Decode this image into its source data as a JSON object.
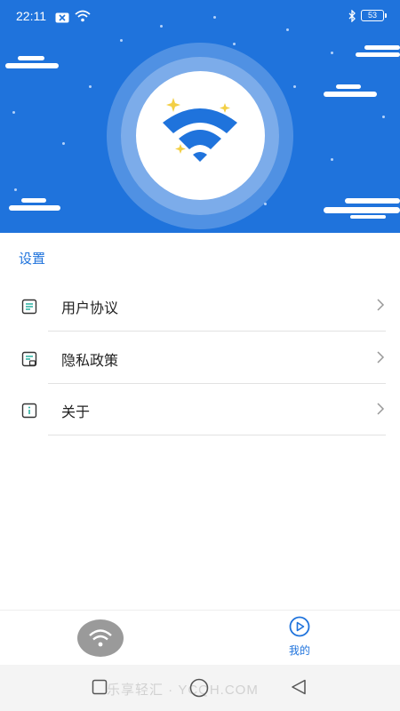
{
  "status_bar": {
    "time": "22:11",
    "battery": "53",
    "icons": [
      "notification-close-icon",
      "wifi-icon",
      "bluetooth-icon",
      "battery-icon"
    ]
  },
  "hero": {
    "icon": "wifi-sparkle-icon",
    "colors": {
      "background": "#1f73dc",
      "accent": "#1f73dc",
      "sparkle": "#f3cf45"
    }
  },
  "settings": {
    "section_title": "设置",
    "items": [
      {
        "label": "用户协议",
        "icon": "document-icon"
      },
      {
        "label": "隐私政策",
        "icon": "privacy-document-icon"
      },
      {
        "label": "关于",
        "icon": "info-icon"
      }
    ]
  },
  "bottom_nav": {
    "items": [
      {
        "icon": "wifi-icon",
        "label": ""
      },
      {
        "icon": "play-circle-icon",
        "label": "我的"
      }
    ]
  },
  "system_nav": {
    "buttons": [
      "recent-apps-button",
      "home-button",
      "back-button"
    ],
    "watermark": "乐享轻汇 · YCQH.COM"
  }
}
